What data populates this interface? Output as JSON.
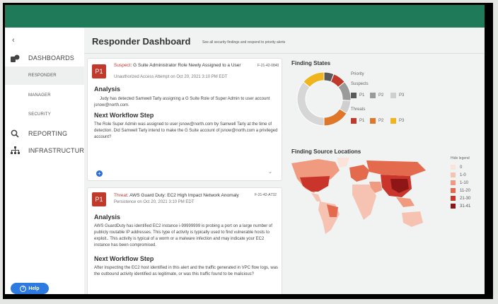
{
  "sidebar": {
    "back_glyph": "‹",
    "items": [
      {
        "label": "DASHBOARDS",
        "icon": "dashboard-icon"
      },
      {
        "label": "RESPONDER",
        "icon": ""
      },
      {
        "label": "MANAGER",
        "icon": ""
      },
      {
        "label": "SECURITY",
        "icon": ""
      },
      {
        "label": "REPORTING",
        "icon": "search-icon"
      },
      {
        "label": "INFRASTRUCTURE",
        "icon": "sitemap-icon"
      }
    ],
    "help_label": "Help"
  },
  "header": {
    "title": "Responder Dashboard",
    "subtitle": "See all security findings and respond to priority alerts"
  },
  "findings": [
    {
      "priority": "P1",
      "kind": "Suspect",
      "title": "G Suite Administrator Role Newly Assigned to a User",
      "id": "F-21-42-0840",
      "subtitle": "Unauthorized Access Attempt on Oct 20, 2021 3:10 PM EDT",
      "analysis_heading": "Analysis",
      "analysis": "Judy has detected Samwell Tarly assigning a G Suite Role of Super Admin to user account jsnow@north.com.",
      "next_heading": "Next Workflow Step",
      "next": "The Role Super Admin was assigned to user jsnow@north.com by Samwell Tarly at the time of detection. Did Samwell Tarly intend to make the G Suite account of jsnow@north.com a privileged account?",
      "plus": "+",
      "chevron": "⌄"
    },
    {
      "priority": "P1",
      "kind": "Threat",
      "title": "AWS Guard Duty: EC2 High Impact Network Anomaly",
      "id": "F-21-42-A732",
      "subtitle": "Persistence on Oct 20, 2021 3:10 PM EDT",
      "analysis_heading": "Analysis",
      "analysis": "AWS GuardDuty has identified EC2 instance i-99999999 is probing a port on a large number of publicly routable IP addresses. This type of activity is typically used to find vulnerable hosts to exploit.. This activity is typical of a worm or a malware infection and may indicate your EC2 instance has been compromised.",
      "next_heading": "Next Workflow Step",
      "next": "After inspecting the EC2 host identified in this alert and the traffic generated in VPC flow logs, was the outbound activity identified as legitimate, or was this traffic found to be malicious?"
    }
  ],
  "finding_states": {
    "title": "Finding States",
    "priority_label": "Priority",
    "suspects_label": "Suspects",
    "threats_label": "Threats",
    "suspects": [
      {
        "label": "P1",
        "color": "#5a5a5a"
      },
      {
        "label": "P2",
        "color": "#9a9a9a"
      },
      {
        "label": "P3",
        "color": "#cfcfcf"
      }
    ],
    "threats": [
      {
        "label": "P1",
        "color": "#c0392b"
      },
      {
        "label": "P2",
        "color": "#e0762a"
      },
      {
        "label": "P3",
        "color": "#f0b51e"
      }
    ],
    "donut": [
      {
        "name": "Suspects P1",
        "value": 6,
        "color": "#5a5a5a"
      },
      {
        "name": "Threats P1",
        "value": 8,
        "color": "#c0392b"
      },
      {
        "name": "Suspects P2",
        "value": 12,
        "color": "#9a9a9a"
      },
      {
        "name": "Suspects P3",
        "value": 8,
        "color": "#cfcfcf"
      },
      {
        "name": "Threats P2",
        "value": 16,
        "color": "#e0762a"
      },
      {
        "name": "Suspects P3b",
        "value": 36,
        "color": "#d6d6d6"
      },
      {
        "name": "Threats P3",
        "value": 14,
        "color": "#f0b51e"
      }
    ]
  },
  "map": {
    "title": "Finding Source Locations",
    "legend_toggle": "Hide legend",
    "legend": [
      {
        "label": "0",
        "color": "#fbe3da"
      },
      {
        "label": "1-0",
        "color": "#f6c3b2"
      },
      {
        "label": "1-10",
        "color": "#f09a80"
      },
      {
        "label": "11-20",
        "color": "#e36a4d"
      },
      {
        "label": "21-30",
        "color": "#c9352a"
      },
      {
        "label": "31-41",
        "color": "#8e1616"
      }
    ]
  }
}
